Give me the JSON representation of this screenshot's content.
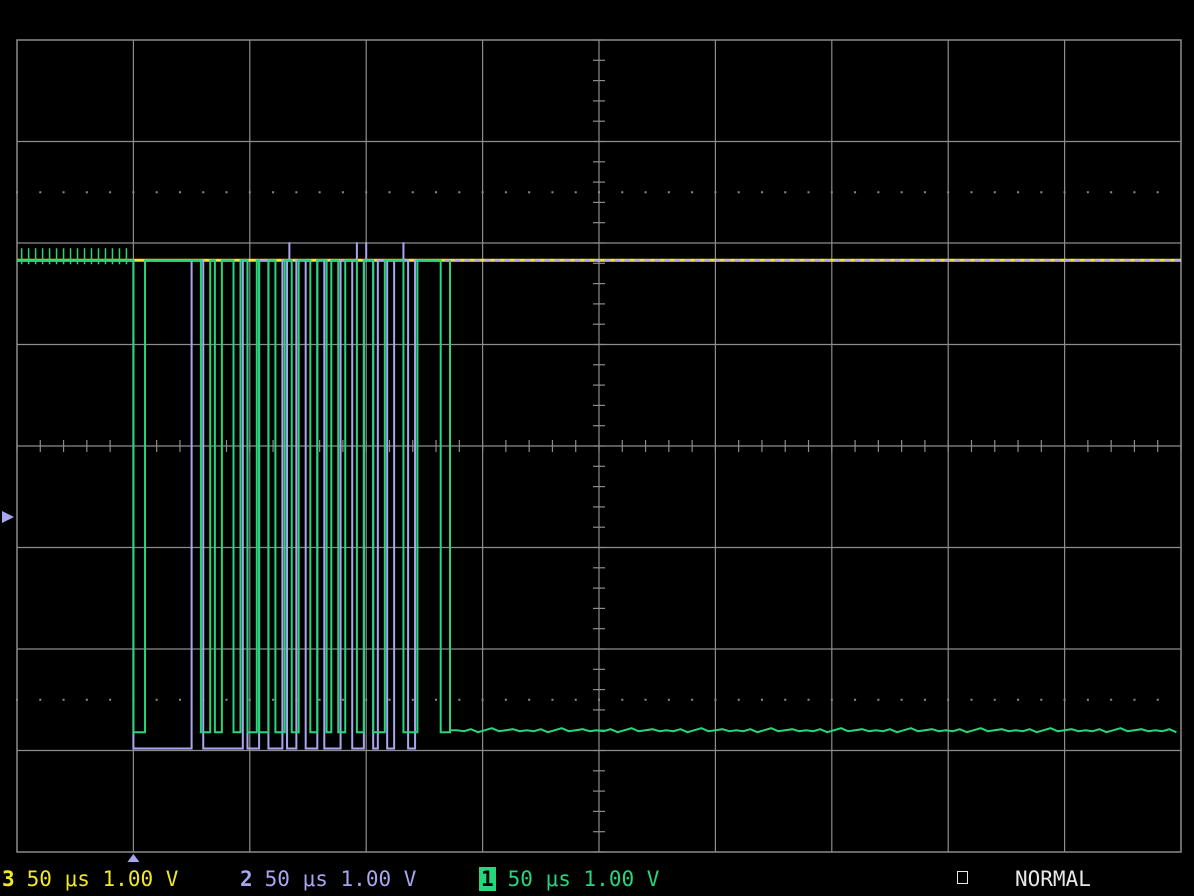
{
  "colors": {
    "background": "#000000",
    "grid": "#8c8c8c",
    "ch1": "#27d67a",
    "ch2": "#a9a5ee",
    "ch3": "#f0e62a"
  },
  "status": {
    "ch3": {
      "num": "3",
      "timebase": "50 μs",
      "volts": "1.00 V"
    },
    "ch2": {
      "num": "2",
      "timebase": "50 μs",
      "volts": "1.00 V"
    },
    "ch1": {
      "num": "1",
      "timebase": "50 μs",
      "volts": "1.00 V"
    },
    "mode": "NORMAL"
  },
  "chart_data": {
    "type": "line",
    "grid": true,
    "divisions": {
      "x": 10,
      "y": 8
    },
    "time_per_div_us": 50,
    "volts_per_div": 1.0,
    "xlim_us": [
      0,
      500
    ],
    "ylim_div": [
      0,
      8
    ],
    "trigger_time_us": 50,
    "series": [
      {
        "channel": "3",
        "color": "#f0e62a",
        "baseline_div": 1.02,
        "segments": [
          {
            "x0": 0,
            "x1": 500,
            "level_div": 5.83
          }
        ]
      },
      {
        "channel": "2",
        "color": "#a9a5ee",
        "baseline_div": 1.02,
        "high_level_div": 5.83,
        "low_level_div": 1.02,
        "transitions_us": [
          50,
          75,
          80,
          97,
          99,
          104,
          108,
          114,
          116,
          120,
          124,
          129,
          132,
          139,
          144,
          149,
          153,
          155,
          159,
          162,
          168,
          171
        ],
        "spikes_us": [
          117,
          146,
          150,
          166
        ]
      },
      {
        "channel": "1",
        "color": "#27d67a",
        "baseline_div": 1.02,
        "high_level_div": 5.83,
        "low_level_div": 1.18,
        "transitions_us": [
          50,
          55,
          79,
          83,
          85,
          88,
          93,
          96,
          99,
          103,
          104,
          108,
          111,
          115,
          118,
          121,
          126,
          129,
          133,
          135,
          138,
          141,
          146,
          149,
          153,
          158,
          166,
          172,
          182,
          186
        ],
        "tail_level_div": 1.2
      }
    ]
  }
}
